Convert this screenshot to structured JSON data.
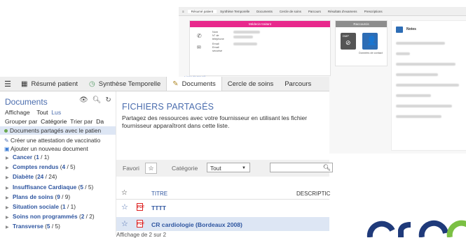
{
  "back": {
    "tabs": [
      "Résumé patient",
      "Synthèse Temporelle",
      "Documents",
      "Cercle de soins",
      "Parcours",
      "Résultats d'examens",
      "Prescriptions"
    ],
    "medecin_header": "Médecin traitant",
    "medecin_fields": [
      "Nom",
      "N° de téléphone",
      "Email",
      "Email sécurisé"
    ],
    "raccourcis_header": "Raccourcis",
    "raccourcis_tile_label": "Données de contact",
    "liens_label": "Liens de travail",
    "notes_title": "Notes"
  },
  "tabbar": {
    "tabs": [
      {
        "label": "Résumé patient",
        "icon": "grid-icon"
      },
      {
        "label": "Synthèse Temporelle",
        "icon": "timeline-icon"
      },
      {
        "label": "Documents",
        "icon": "edit-document-icon"
      },
      {
        "label": "Cercle de soins",
        "icon": ""
      },
      {
        "label": "Parcours",
        "icon": ""
      }
    ],
    "active": "Documents"
  },
  "sidebar": {
    "title": "Documents",
    "affichage_label": "Affichage",
    "affichage_tout": "Tout",
    "affichage_lus": "Lus",
    "grouper_label": "Grouper par",
    "grouper_categorie": "Catégorie",
    "grouper_trier": "Trier par",
    "grouper_da": "Da",
    "shared_docs": "Documents partagés avec le patien",
    "create_vaccination": "Créer une attestation de vaccinatio",
    "add_document": "Ajouter un nouveau document",
    "categories": [
      {
        "name": "Cancer",
        "read": "1",
        "total": "1"
      },
      {
        "name": "Comptes rendus",
        "read": "4",
        "total": "5"
      },
      {
        "name": "Diabète",
        "read": "24",
        "total": "24"
      },
      {
        "name": "Insuffisance Cardiaque",
        "read": "5",
        "total": "5"
      },
      {
        "name": "Plans de soins",
        "read": "9",
        "total": "9"
      },
      {
        "name": "Situation sociale",
        "read": "1",
        "total": "1"
      },
      {
        "name": "Soins non programmés",
        "read": "2",
        "total": "2"
      },
      {
        "name": "Transverse",
        "read": "5",
        "total": "5"
      }
    ]
  },
  "main": {
    "title": "FICHIERS PARTAGÉS",
    "description_line1": "Partagez des ressources avec votre fournisseur en utilisant les fichier",
    "description_line2": "fournisseur apparaîtront dans cette liste.",
    "favori_label": "Favori",
    "categorie_label": "Catégorie",
    "categorie_value": "Tout",
    "columns": {
      "titre": "TITRE",
      "description": "DESCRIPTIC"
    },
    "rows": [
      {
        "title": "TTTT"
      },
      {
        "title": "CR cardiologie (Bordeaux 2008)"
      }
    ],
    "count_text": "Affichage de 2 sur 2"
  },
  "colors": {
    "accent_blue": "#4b6dae",
    "link_blue": "#2f56a0",
    "pink_header": "#e8288c",
    "selected_row": "#dde6f4",
    "logo_navy": "#1f3a7a",
    "logo_green": "#7bc043"
  }
}
